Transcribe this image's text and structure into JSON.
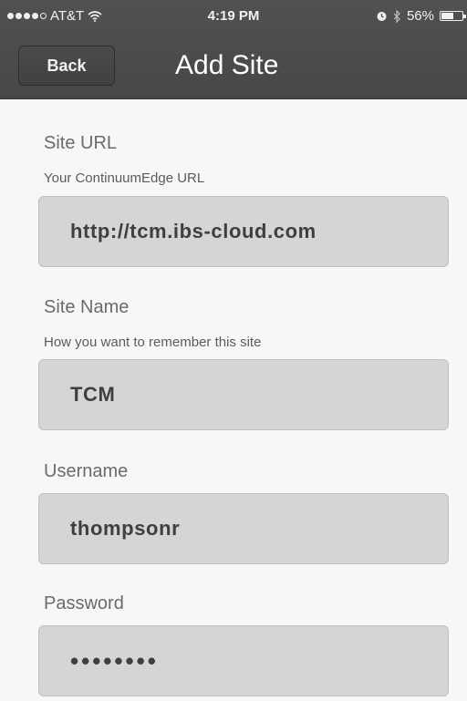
{
  "status_bar": {
    "carrier": "AT&T",
    "time": "4:19 PM",
    "battery": "56%",
    "battery_level": 0.56,
    "icons": [
      "signal-dots-icon",
      "wifi-icon",
      "alarm-icon",
      "bluetooth-icon",
      "battery-icon"
    ]
  },
  "nav": {
    "back_label": "Back",
    "title": "Add Site"
  },
  "form": {
    "site_url": {
      "label": "Site URL",
      "hint": "Your ContinuumEdge URL",
      "value": "http://tcm.ibs-cloud.com"
    },
    "site_name": {
      "label": "Site Name",
      "hint": "How you want to remember this site",
      "value": "TCM"
    },
    "username": {
      "label": "Username",
      "value": "thompsonr"
    },
    "password": {
      "label": "Password",
      "value": "••••••••"
    }
  }
}
